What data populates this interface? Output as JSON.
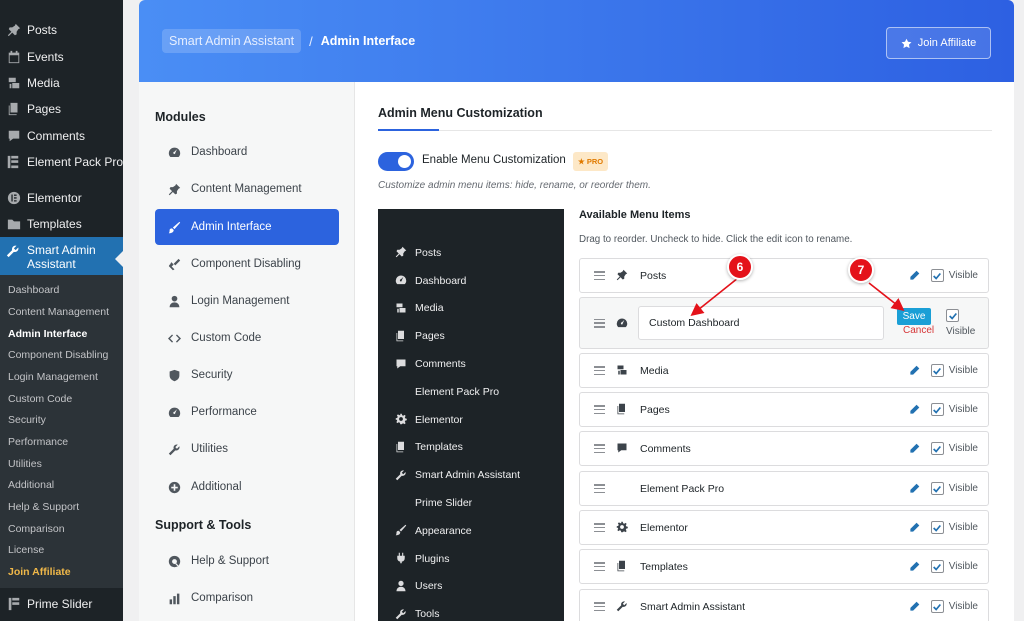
{
  "wp_menu": {
    "top_items": [
      {
        "label": "Posts",
        "icon": "pin-icon"
      },
      {
        "label": "Events",
        "icon": "calendar-icon"
      },
      {
        "label": "Media",
        "icon": "media-icon"
      },
      {
        "label": "Pages",
        "icon": "pages-icon"
      },
      {
        "label": "Comments",
        "icon": "comment-icon"
      },
      {
        "label": "Element Pack Pro",
        "icon": "element-pack-icon"
      },
      {
        "label": "Elementor",
        "icon": "elementor-icon"
      },
      {
        "label": "Templates",
        "icon": "folder-icon"
      }
    ],
    "active_label": "Smart Admin Assistant",
    "sub_items": [
      "Dashboard",
      "Content Management",
      "Admin Interface",
      "Component Disabling",
      "Login Management",
      "Custom Code",
      "Security",
      "Performance",
      "Utilities",
      "Additional",
      "Help & Support",
      "Comparison",
      "License",
      "Join Affiliate"
    ],
    "bottom_label": "Prime Slider"
  },
  "header": {
    "breadcrumb_root": "Smart Admin Assistant",
    "breadcrumb_sep": "/",
    "breadcrumb_current": "Admin Interface",
    "join_label": "Join Affiliate"
  },
  "sidebar": {
    "modules_title": "Modules",
    "modules": [
      {
        "label": "Dashboard",
        "icon": "gauge-icon"
      },
      {
        "label": "Content Management",
        "icon": "pin-icon"
      },
      {
        "label": "Admin Interface",
        "icon": "brush-icon"
      },
      {
        "label": "Component Disabling",
        "icon": "tools-icon"
      },
      {
        "label": "Login Management",
        "icon": "user-icon"
      },
      {
        "label": "Custom Code",
        "icon": "code-icon"
      },
      {
        "label": "Security",
        "icon": "shield-icon"
      },
      {
        "label": "Performance",
        "icon": "speed-icon"
      },
      {
        "label": "Utilities",
        "icon": "wrench-icon"
      },
      {
        "label": "Additional",
        "icon": "plus-circle-icon"
      }
    ],
    "support_title": "Support & Tools",
    "support": [
      {
        "label": "Help & Support",
        "icon": "lifebuoy-icon"
      },
      {
        "label": "Comparison",
        "icon": "bar-chart-icon"
      }
    ]
  },
  "main": {
    "section_title": "Admin Menu Customization",
    "toggle_label": "Enable Menu Customization",
    "pro_badge": "PRO",
    "description": "Customize admin menu items: hide, rename, or reorder them.",
    "preview_items": [
      {
        "label": "Posts",
        "icon": "pin-icon"
      },
      {
        "label": "Dashboard",
        "icon": "gauge-icon"
      },
      {
        "label": "Media",
        "icon": "media-icon"
      },
      {
        "label": "Pages",
        "icon": "pages-icon"
      },
      {
        "label": "Comments",
        "icon": "comment-icon"
      },
      {
        "label": "Element Pack Pro",
        "icon": ""
      },
      {
        "label": "Elementor",
        "icon": "gear-icon"
      },
      {
        "label": "Templates",
        "icon": "pages-icon"
      },
      {
        "label": "Smart Admin Assistant",
        "icon": "wrench-icon"
      },
      {
        "label": "Prime Slider",
        "icon": ""
      },
      {
        "label": "Appearance",
        "icon": "brush-icon"
      },
      {
        "label": "Plugins",
        "icon": "plug-icon"
      },
      {
        "label": "Users",
        "icon": "user-icon"
      },
      {
        "label": "Tools",
        "icon": "wrench-icon"
      }
    ],
    "available_title": "Available Menu Items",
    "available_desc": "Drag to reorder. Uncheck to hide. Click the edit icon to rename.",
    "visible_label": "Visible",
    "rows": [
      {
        "label": "Posts",
        "icon": "pin-icon"
      },
      {
        "label": "Custom Dashboard",
        "icon": "gauge-icon",
        "editing": true
      },
      {
        "label": "Media",
        "icon": "media-icon"
      },
      {
        "label": "Pages",
        "icon": "pages-icon"
      },
      {
        "label": "Comments",
        "icon": "comment-icon"
      },
      {
        "label": "Element Pack Pro",
        "icon": ""
      },
      {
        "label": "Elementor",
        "icon": "gear-icon"
      },
      {
        "label": "Templates",
        "icon": "pages-icon"
      },
      {
        "label": "Smart Admin Assistant",
        "icon": "wrench-icon"
      }
    ],
    "save_label": "Save",
    "cancel_label": "Cancel",
    "markers": [
      "6",
      "7"
    ],
    "marker_color": "#e4121a",
    "accent_color": "#2c63de"
  }
}
